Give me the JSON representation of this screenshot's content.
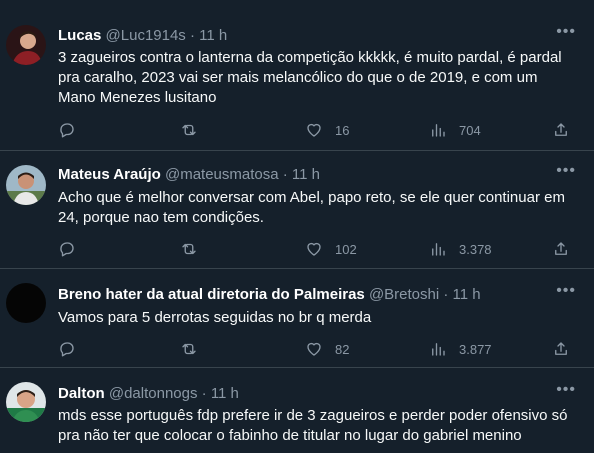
{
  "tweets": [
    {
      "name": "Lucas",
      "handle": "@Luc1914s",
      "dot": "·",
      "time": "11 h",
      "text": "3 zagueiros contra o lanterna da competição kkkkk, é muito pardal, é pardal pra caralho, 2023 vai ser mais melancólico do que o de 2019, e com um Mano Menezes lusitano",
      "replies": "",
      "retweets": "",
      "likes": "16",
      "views": "704"
    },
    {
      "name": "Mateus Araújo",
      "handle": "@mateusmatosa",
      "dot": "·",
      "time": "11 h",
      "text": "Acho que é melhor conversar com Abel, papo reto, se ele quer continuar em 24, porque nao tem condições.",
      "replies": "",
      "retweets": "",
      "likes": "102",
      "views": "3.378"
    },
    {
      "name": "Breno hater da atual diretoria do Palmeiras",
      "handle": "@Bretoshi",
      "dot": "·",
      "time": "11 h",
      "text": "Vamos para 5 derrotas seguidas no br q merda",
      "replies": "",
      "retweets": "",
      "likes": "82",
      "views": "3.877"
    },
    {
      "name": "Dalton",
      "handle": "@daltonnogs",
      "dot": "·",
      "time": "11 h",
      "text": "mds esse português fdp prefere ir de 3 zagueiros e perder poder ofensivo só pra não ter que colocar o fabinho de titular no lugar do gabriel menino"
    }
  ],
  "icons": {
    "reply": "reply-icon",
    "retweet": "retweet-icon",
    "like": "heart-icon",
    "views": "views-icon",
    "share": "share-icon",
    "more": "more-icon"
  },
  "colors": {
    "background": "#15202b",
    "divider": "#38444d",
    "muted": "#8b98a5"
  }
}
